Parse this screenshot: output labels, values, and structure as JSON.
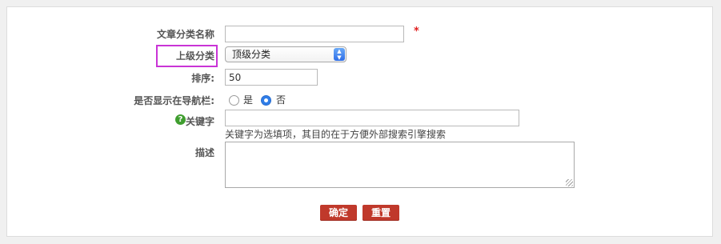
{
  "form": {
    "title_label": "文章分类名称",
    "title_value": "",
    "required_mark": "*",
    "parent_label": "上级分类",
    "parent_selected": "顶级分类",
    "sort_label": "排序:",
    "sort_value": "50",
    "nav_label": "是否显示在导航栏:",
    "nav_options": [
      {
        "label": "是",
        "checked": false
      },
      {
        "label": "否",
        "checked": true
      }
    ],
    "keyword_label": "关键字",
    "keyword_value": "",
    "keyword_hint": "关键字为选填项，其目的在于方便外部搜索引擎搜索",
    "desc_label": "描述",
    "desc_value": ""
  },
  "buttons": {
    "confirm": "确定",
    "reset": "重置"
  },
  "colors": {
    "highlight": "#c934d6",
    "button_bg": "#c0392b",
    "required": "#e02020",
    "radio_checked": "#2f7de8"
  },
  "icons": {
    "help": "question-circle-icon",
    "select_arrow": "updown-chevron-icon",
    "resize": "resize-grip-icon"
  }
}
